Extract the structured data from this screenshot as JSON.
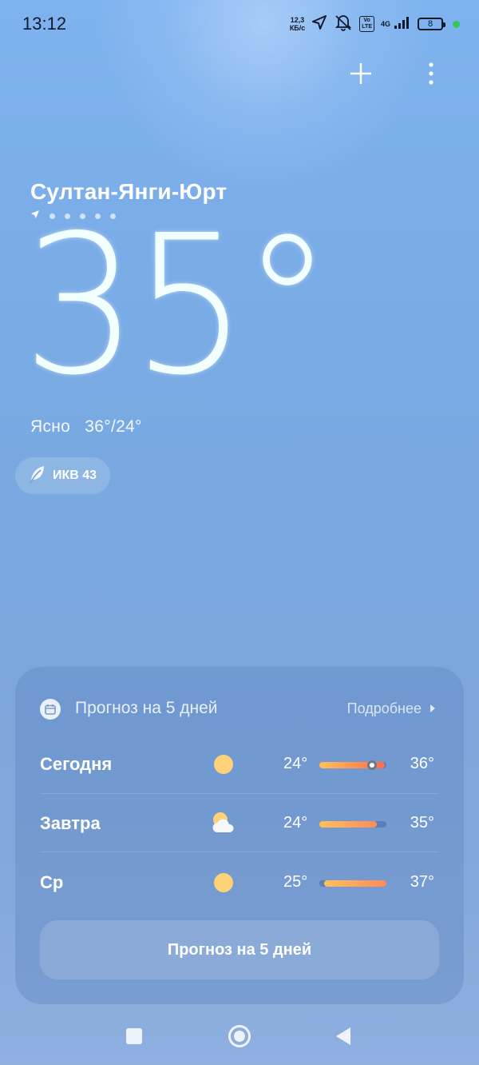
{
  "status_bar": {
    "time": "13:12",
    "net_speed_value": "12,3",
    "net_speed_unit": "КБ/с",
    "volte_top": "Vo",
    "volte_bottom": "LTE",
    "network_type": "4G",
    "battery_level": "8"
  },
  "header": {
    "add_icon": "plus-icon",
    "menu_icon": "more-vertical-icon"
  },
  "location": {
    "city": "Султан-Янги-Юрт",
    "pages_total": 6,
    "current_page": 1
  },
  "current": {
    "temperature": "35°",
    "condition": "Ясно",
    "high_low": "36°/24°",
    "aqi_label": "ИКВ 43"
  },
  "forecast_card": {
    "title": "Прогноз на 5 дней",
    "more_label": "Подробнее",
    "button_label": "Прогноз на 5 дней",
    "days": [
      {
        "day": "Сегодня",
        "icon": "sun-icon",
        "low": "24°",
        "high": "36°"
      },
      {
        "day": "Завтра",
        "icon": "partly-cloudy-icon",
        "low": "24°",
        "high": "35°"
      },
      {
        "day": "Ср",
        "icon": "sun-icon",
        "low": "25°",
        "high": "37°"
      }
    ]
  },
  "colors": {
    "sun": "#ffd27a",
    "bar_warm_start": "#ffc15a",
    "bar_warm_end": "#ff8a5a",
    "status_dot": "#34c759"
  }
}
